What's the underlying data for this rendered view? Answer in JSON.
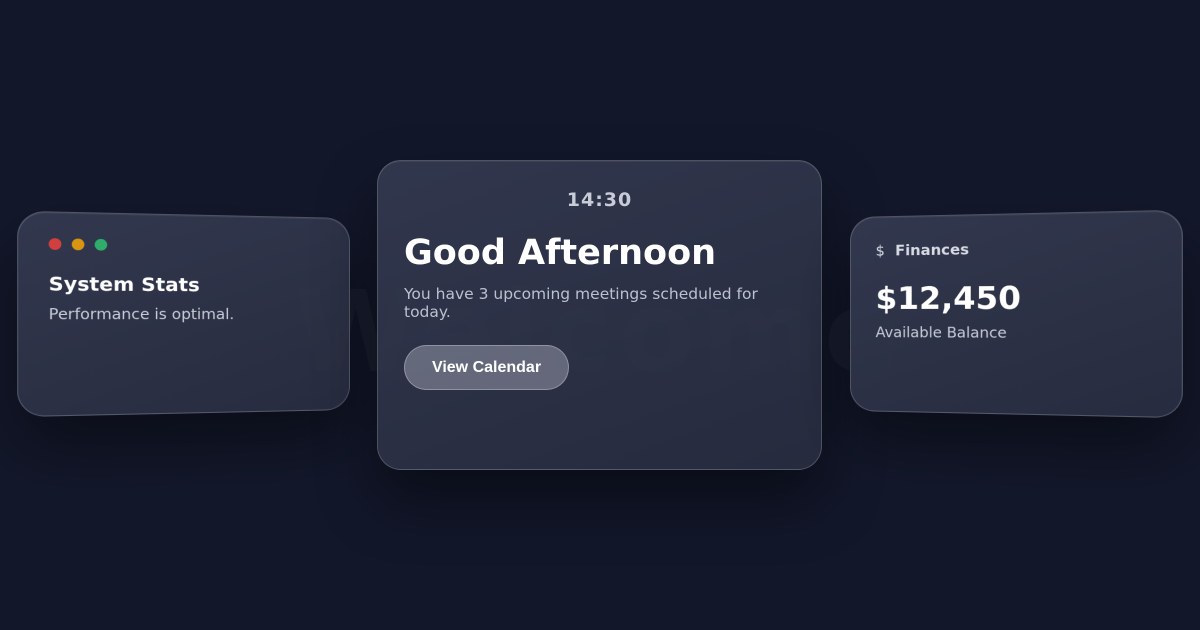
{
  "left_card": {
    "window_dots": [
      {
        "color": "#d23f3f"
      },
      {
        "color": "#d99512"
      },
      {
        "color": "#2fae6b"
      }
    ],
    "title": "System Stats",
    "subtitle": "Performance is optimal."
  },
  "center_card": {
    "time": "14:30",
    "greeting": "Good Afternoon",
    "message": "You have 3 upcoming meetings scheduled for today.",
    "button_label": "View Calendar"
  },
  "right_card": {
    "icon": "dollar-icon",
    "icon_glyph": "$",
    "title": "Finances",
    "amount": "$12,450",
    "amount_label": "Available Balance"
  },
  "colors": {
    "background": "#12172a",
    "card": "#2e3347",
    "text_primary": "#ffffff",
    "text_secondary": "#c8ccd8"
  }
}
